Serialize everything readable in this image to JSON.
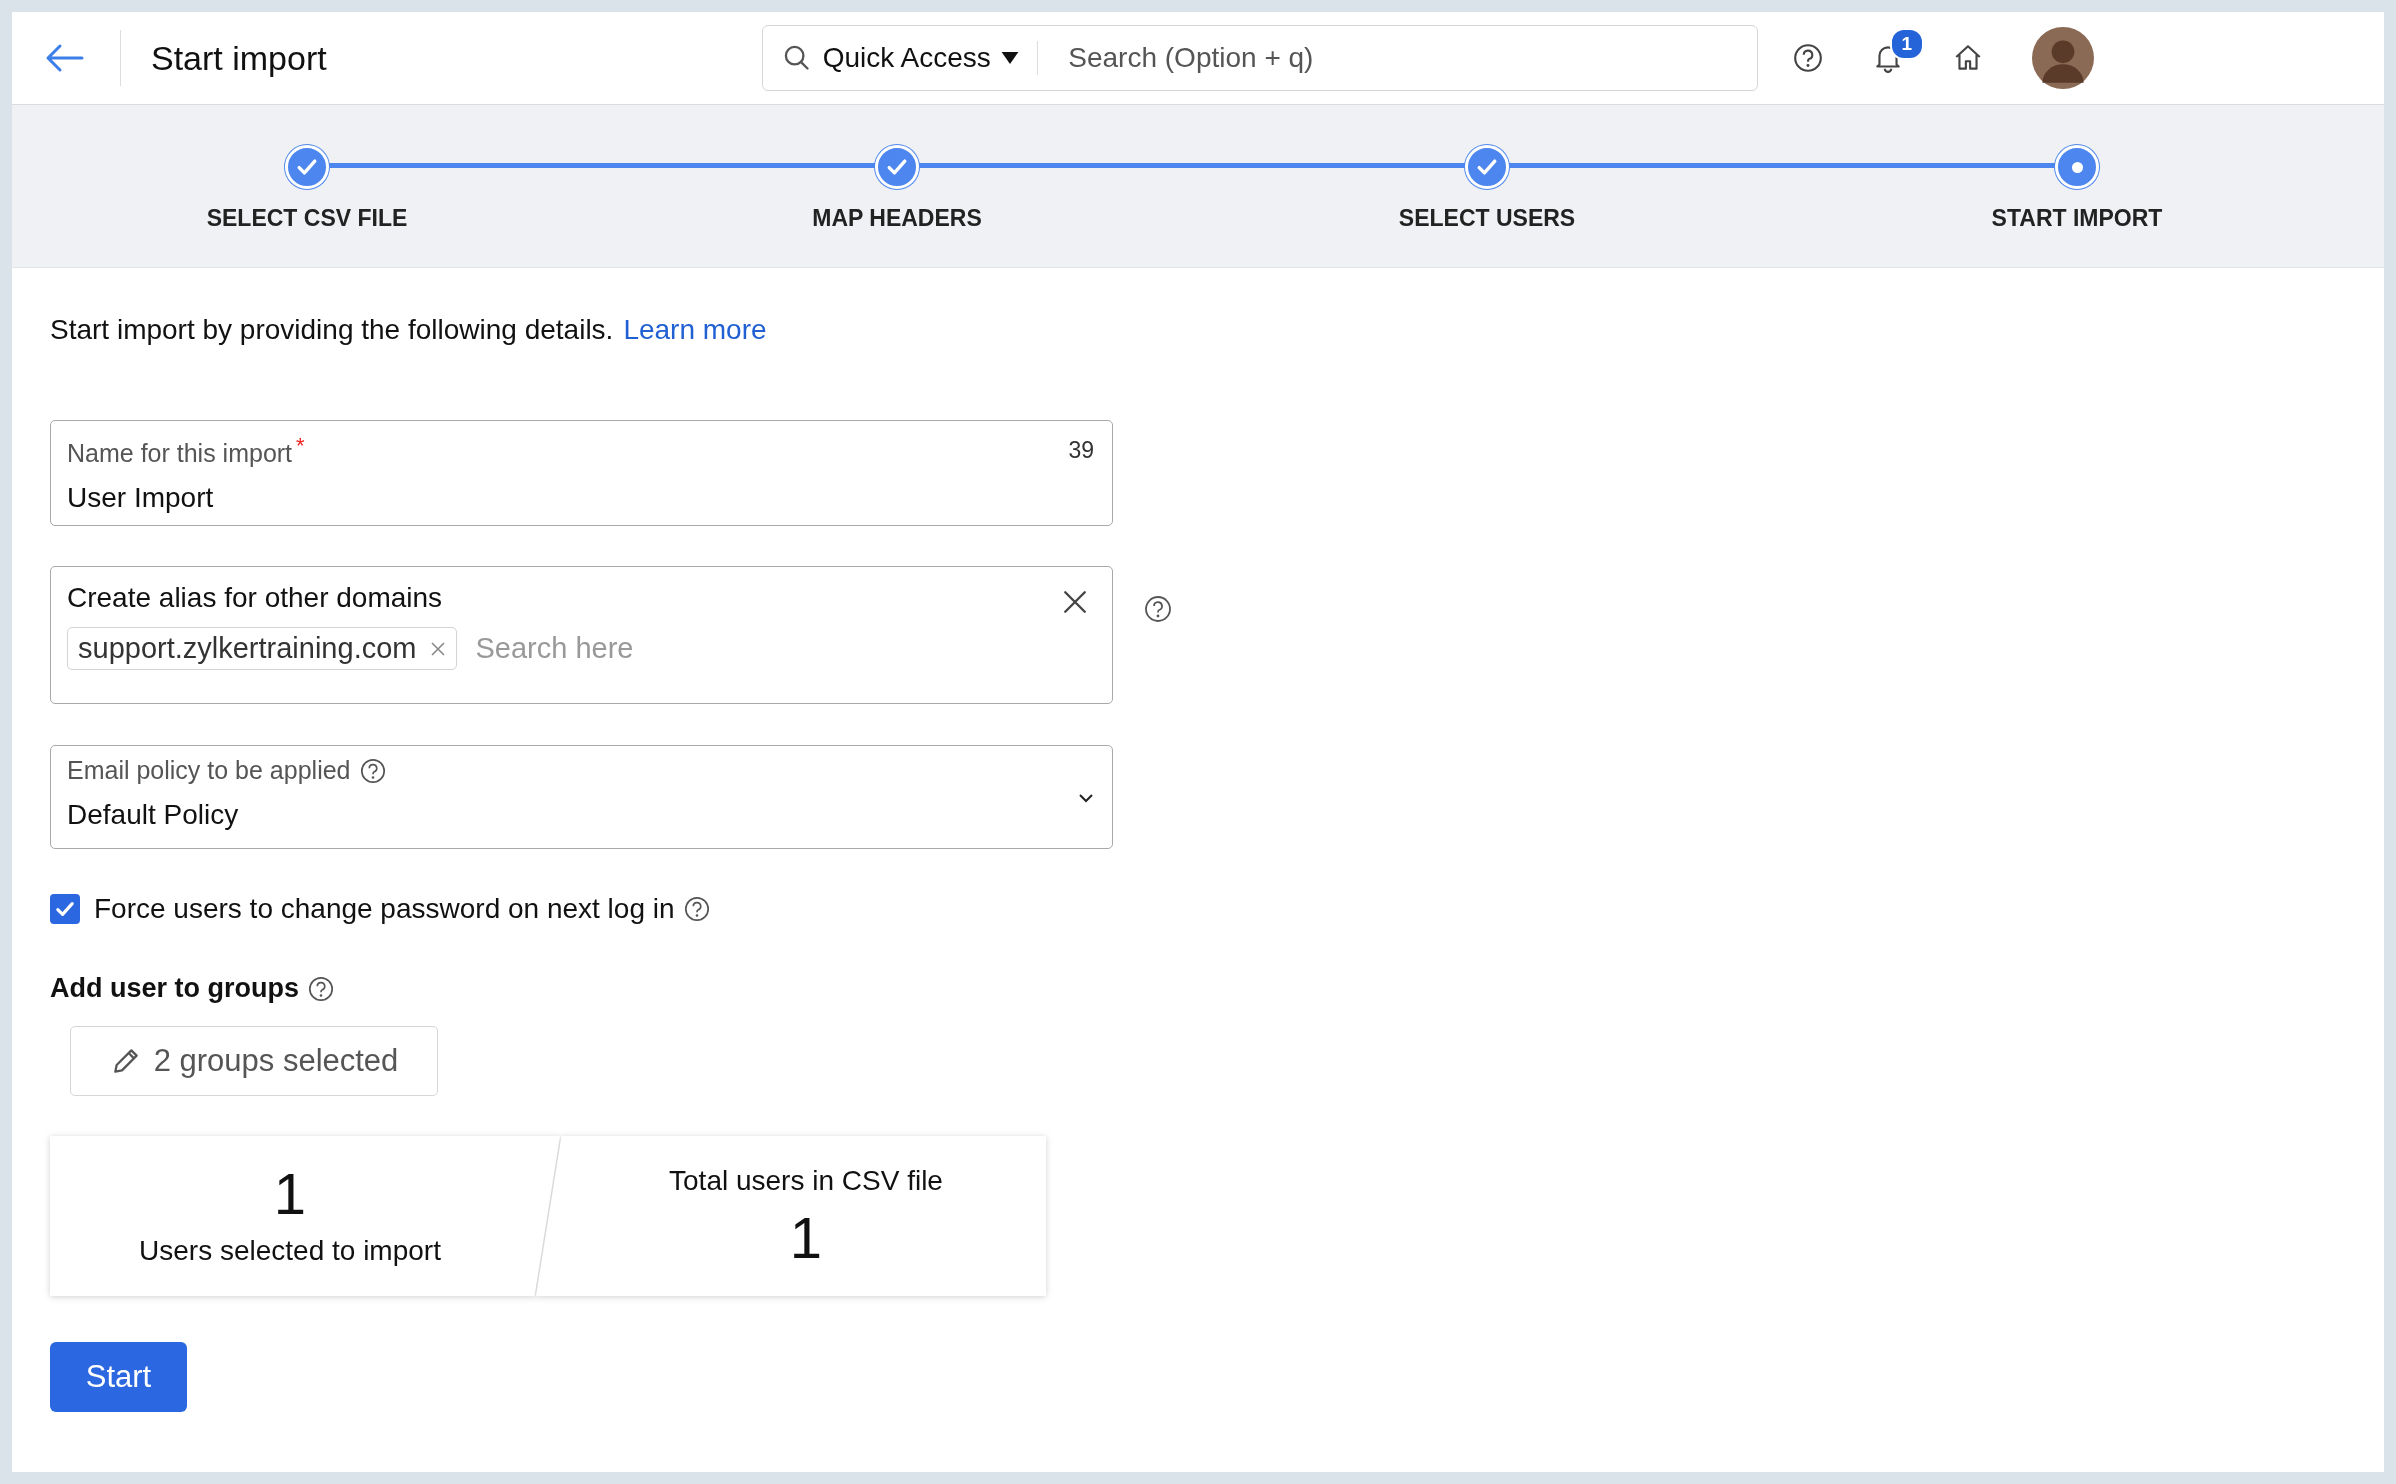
{
  "header": {
    "title": "Start import",
    "quick_access": "Quick Access",
    "search": {
      "placeholder": "Search (Option + q)"
    },
    "notification_count": "1"
  },
  "steps": [
    {
      "label": "SELECT CSV FILE",
      "completed": true
    },
    {
      "label": "MAP HEADERS",
      "completed": true
    },
    {
      "label": "SELECT USERS",
      "completed": true
    },
    {
      "label": "START IMPORT",
      "completed": false
    }
  ],
  "intro": {
    "text": "Start import by providing the following details.",
    "link": "Learn more"
  },
  "name_field": {
    "label": "Name for this import",
    "required_mark": "*",
    "counter": "39",
    "value": "User Import"
  },
  "alias_field": {
    "label": "Create alias for other domains",
    "tags": [
      "support.zylkertraining.com"
    ],
    "placeholder": "Search here"
  },
  "policy_field": {
    "label": "Email policy to be applied",
    "value": "Default Policy"
  },
  "force_password": {
    "label": "Force users to change password on next log in",
    "checked": true
  },
  "groups": {
    "heading": "Add user to groups",
    "button": "2 groups selected"
  },
  "summary": [
    {
      "number": "1",
      "label": "Users selected to import"
    },
    {
      "number": "1",
      "label": "Total users in CSV file"
    }
  ],
  "start_button": "Start"
}
